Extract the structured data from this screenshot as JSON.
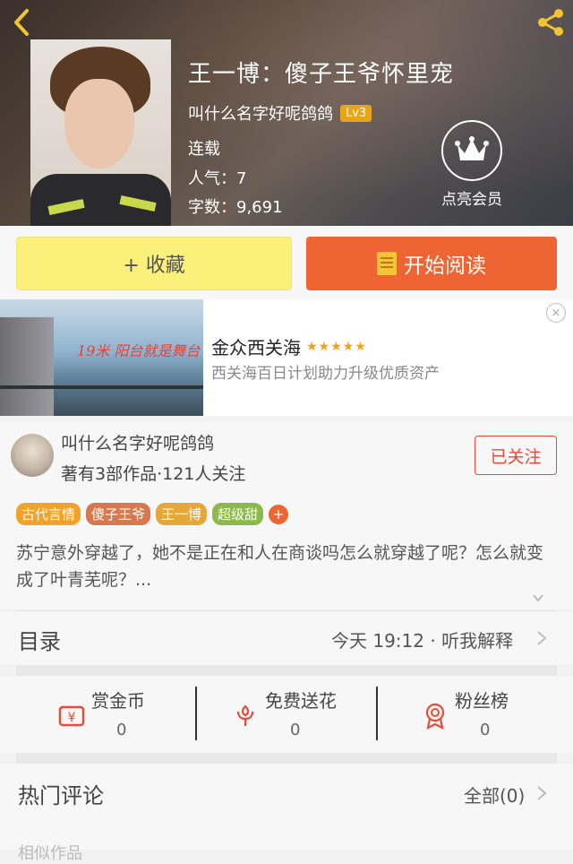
{
  "header": {
    "book_title": "王一博：傻子王爷怀里宠",
    "author_name": "叫什么名字好呢鸽鸽",
    "level_badge": "Lv3",
    "status": "连载",
    "popularity": "人气：7",
    "word_count": "字数：9,691",
    "vip_label": "点亮会员"
  },
  "actions": {
    "collect_label": "+ 收藏",
    "read_label": "开始阅读"
  },
  "ad": {
    "slogan": "19米 阳台就是舞台",
    "title": "金众西关海",
    "stars": "★★★★★",
    "subtitle": "西关海百日计划助力升级优质资产",
    "close_symbol": "×"
  },
  "author": {
    "name": "叫什么名字好呢鸽鸽",
    "stats": "著有3部作品·121人关注",
    "follow_label": "已关注"
  },
  "tags": [
    {
      "label": "古代言情",
      "color": "#f0a22a"
    },
    {
      "label": "傻子王爷",
      "color": "#d8784e"
    },
    {
      "label": "王一博",
      "color": "#e6a73a"
    },
    {
      "label": "超级甜",
      "color": "#8bb94a"
    }
  ],
  "tag_add": "+",
  "synopsis": "苏宁意外穿越了，她不是正在和人在商谈吗怎么就穿越了呢？怎么就变成了叶青芜呢？...",
  "toc": {
    "title": "目录",
    "latest": "今天 19:12 · 听我解释"
  },
  "rewards": [
    {
      "label": "赏金币",
      "count": "0",
      "icon": "coin-icon"
    },
    {
      "label": "免费送花",
      "count": "0",
      "icon": "flower-icon"
    },
    {
      "label": "粉丝榜",
      "count": "0",
      "icon": "medal-icon"
    }
  ],
  "comments": {
    "title": "热门评论",
    "all_label": "全部(0)",
    "next_section_partial": "相似作品"
  },
  "colors": {
    "accent_orange": "#ef6433",
    "collect_yellow": "#fbf17a",
    "follow_red": "#e84a3a",
    "level_gold": "#e9a51a",
    "star_orange": "#f4a01a"
  }
}
